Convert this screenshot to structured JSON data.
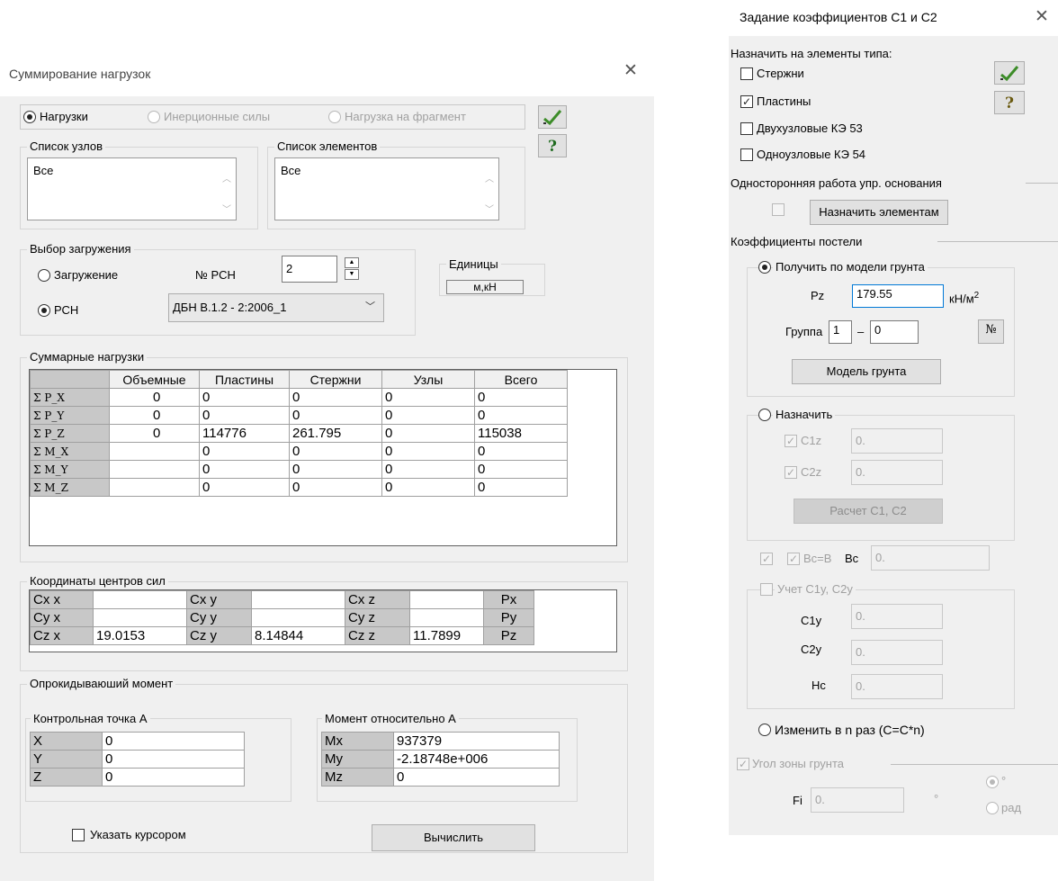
{
  "left_dialog": {
    "title": "Суммирование нагрузок",
    "close_icon": "close-icon",
    "mode_radios": [
      "Нагрузки",
      "Инерционные силы",
      "Нагрузка на фрагмент"
    ],
    "node_list": {
      "title": "Список узлов",
      "value": "Все"
    },
    "element_list": {
      "title": "Список элементов",
      "value": "Все"
    },
    "load_choice": {
      "title": "Выбор загружения",
      "radio_load": "Загружение",
      "radio_rsn": "РСН",
      "rsn_number_label": "№ РСН",
      "rsn_number_value": "2",
      "rsn_select_value": "ДБН В.1.2 - 2:2006_1"
    },
    "units": {
      "title": "Единицы",
      "value": "м,кН"
    },
    "summary": {
      "title": "Суммарные нагрузки",
      "columns": [
        "Объемные",
        "Пластины",
        "Стержни",
        "Узлы",
        "Всего"
      ],
      "rows": [
        {
          "label": "Σ P_X",
          "cells": [
            "0",
            "0",
            "0",
            "0",
            "0"
          ]
        },
        {
          "label": "Σ P_Y",
          "cells": [
            "0",
            "0",
            "0",
            "0",
            "0"
          ]
        },
        {
          "label": "Σ P_Z",
          "cells": [
            "0",
            "114776",
            "261.795",
            "0",
            "115038"
          ]
        },
        {
          "label": "Σ M_X",
          "cells": [
            "",
            "0",
            "0",
            "0",
            "0"
          ]
        },
        {
          "label": "Σ M_Y",
          "cells": [
            "",
            "0",
            "0",
            "0",
            "0"
          ]
        },
        {
          "label": "Σ M_Z",
          "cells": [
            "",
            "0",
            "0",
            "0",
            "0"
          ]
        }
      ]
    },
    "centers": {
      "title": "Координаты центров сил",
      "rows": [
        [
          "Cx x",
          "",
          "Cx y",
          "",
          "Cx z",
          "",
          "Px"
        ],
        [
          "Cy x",
          "",
          "Cy y",
          "",
          "Cy z",
          "",
          "Py"
        ],
        [
          "Cz x",
          "19.0153",
          "Cz y",
          "8.14844",
          "Cz z",
          "11.7899",
          "Pz"
        ]
      ]
    },
    "overturning": {
      "title": "Опрокидываюший момент",
      "control_point": {
        "title": "Контрольная точка А",
        "rows": [
          [
            "X",
            "0"
          ],
          [
            "Y",
            "0"
          ],
          [
            "Z",
            "0"
          ]
        ]
      },
      "moment": {
        "title": "Момент относительно А",
        "rows": [
          [
            "Mx",
            "937379"
          ],
          [
            "My",
            "-2.18748e+006"
          ],
          [
            "Mz",
            "0"
          ]
        ]
      }
    },
    "cursor_checkbox": "Указать курсором",
    "compute_button": "Вычислить",
    "ok_icon": "checkmark-icon",
    "help_icon": "question-icon"
  },
  "right_dialog": {
    "title": "Задание коэффициентов С1 и С2",
    "close_icon": "close-icon",
    "assign_types_label": "Назначить на элементы типа:",
    "element_types": [
      {
        "label": "Стержни",
        "checked": false
      },
      {
        "label": "Пластины",
        "checked": true
      },
      {
        "label": "Двухузловые КЭ 53",
        "checked": false
      },
      {
        "label": "Одноузловые КЭ 54",
        "checked": false
      }
    ],
    "one_sided": {
      "title": "Односторонняя работа упр. основания",
      "button": "Назначить элементам"
    },
    "bed_coeffs": {
      "title": "Коэффициенты постели",
      "from_model": {
        "label": "Получить по модели грунта",
        "pz_label": "Pz",
        "pz_value": "179.55",
        "pz_unit": "кН/м",
        "pz_unit_sup": "2",
        "group_label": "Группа",
        "group_from": "1",
        "group_dash": "–",
        "group_to": "0",
        "number_button": "№",
        "model_button": "Модель грунта"
      },
      "assign": {
        "label": "Назначить",
        "c1z_label": "C1z",
        "c1z_value": "0.",
        "c2z_label": "C2z",
        "c2z_value": "0.",
        "calc_button": "Расчет С1, С2"
      },
      "bc_eq_label": "Bc=B",
      "bc_label": "Bc",
      "bc_value": "0.",
      "account": {
        "label": "Учет C1y, C2y",
        "c1y_label": "C1y",
        "c1y_value": "0.",
        "c2y_label": "C2y",
        "c2y_value": "0.",
        "hc_label": "Hc",
        "hc_value": "0."
      },
      "change_label": "Изменить в  n  раз (C=C*n)"
    },
    "soil_angle": {
      "title": "Угол зоны грунта",
      "fi_label": "Fi",
      "fi_value": "0.",
      "degree_sign": "°",
      "unit_deg": "°",
      "unit_rad": "рад"
    },
    "ok_icon": "checkmark-icon",
    "help_icon": "question-icon"
  }
}
